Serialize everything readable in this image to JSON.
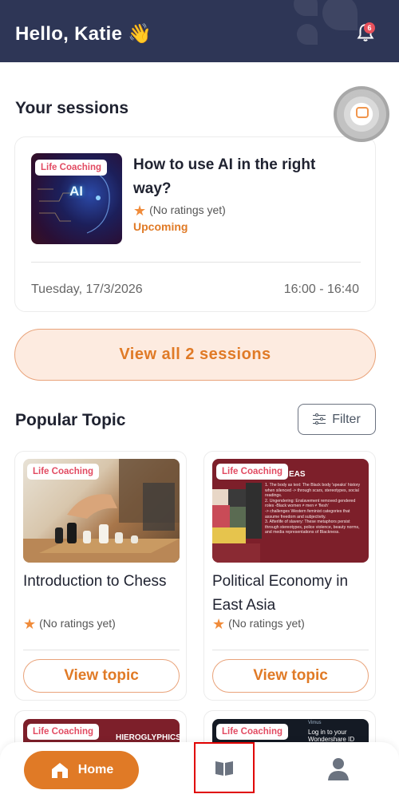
{
  "header": {
    "greeting": "Hello, Katie 👋",
    "notification_count": "6"
  },
  "sessions": {
    "title": "Your sessions",
    "card": {
      "tag": "Life Coaching",
      "image_text": "AI",
      "title": "How to use AI in the right way?",
      "rating": "(No ratings yet)",
      "status": "Upcoming",
      "date": "Tuesday, 17/3/2026",
      "time": "16:00 - 16:40"
    },
    "view_all_label": "View all 2 sessions"
  },
  "popular": {
    "title": "Popular Topic",
    "filter_label": "Filter",
    "topics": [
      {
        "tag": "Life Coaching",
        "title": "Introduction to Chess",
        "rating": "(No ratings yet)",
        "button": "View topic"
      },
      {
        "tag": "Life Coaching",
        "title": "Political Economy in East Asia",
        "rating": "(No ratings yet)",
        "button": "View topic",
        "image_text": {
          "heading": "EAS",
          "lines": [
            "1. The body as text: The Black body 'speaks' history when silenced -> through scars, stereotypes, social readings.",
            "2. Ungendering: Enslavement removed gendered roles -Black women ≠ men ≠ 'flesh'",
            "-> challenges Western feminist categories that assume freedom and subjectivity.",
            "3. Afterlife of slavery: These metaphors persist through stereotypes, police violence, beauty norms, and media representations of Blackness."
          ]
        }
      }
    ],
    "peek": [
      {
        "tag": "Life Coaching",
        "image_text": "HIEROGLYPHICS"
      },
      {
        "tag": "Life Coaching",
        "image_text_top": "Vimus",
        "image_text": "Log in to your Wondershare ID"
      }
    ]
  },
  "nav": {
    "home_label": "Home"
  },
  "colors": {
    "accent": "#e07a26",
    "header_bg": "#2e3656",
    "tag_text": "#e24b62",
    "highlight_box": "#e00000"
  }
}
